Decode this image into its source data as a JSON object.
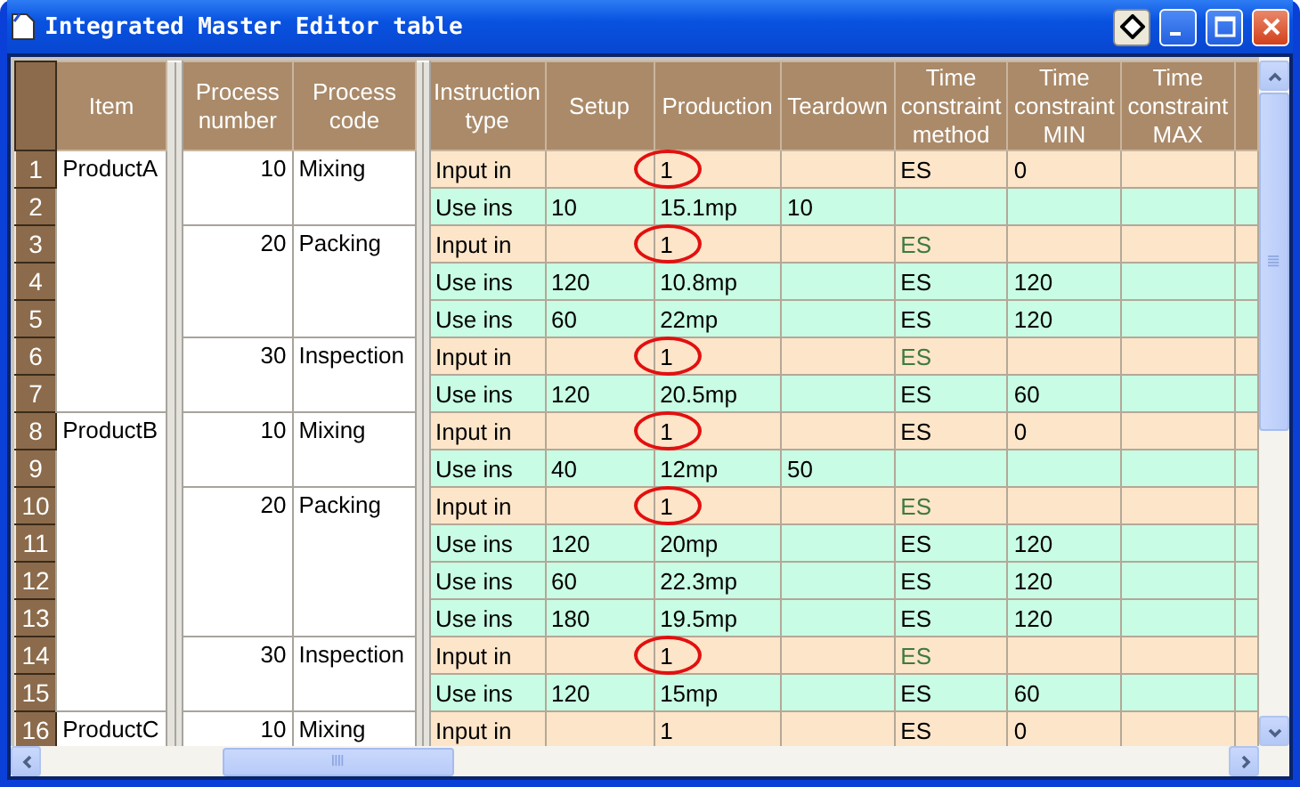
{
  "window": {
    "title": "Integrated Master Editor table"
  },
  "columns": {
    "item": "Item",
    "process_number": "Process number",
    "process_code": "Process code",
    "instruction_type": "Instruction type",
    "setup": "Setup",
    "production": "Production",
    "teardown": "Teardown",
    "method": "Time constraint method",
    "min": "Time constraint MIN",
    "max": "Time constraint MAX"
  },
  "products": [
    {
      "item": "ProductA",
      "processes": [
        {
          "number": "10",
          "code": "Mixing",
          "instructions": [
            {
              "row": "1",
              "kind": "input",
              "type": "Input in",
              "production": "1",
              "circled": true,
              "method": "ES",
              "method_dimmed": false,
              "min": "0"
            },
            {
              "row": "2",
              "kind": "use",
              "type": "Use ins",
              "setup": "10",
              "production": "15.1mp",
              "circled": false,
              "teardown": "10"
            }
          ]
        },
        {
          "number": "20",
          "code": "Packing",
          "instructions": [
            {
              "row": "3",
              "kind": "input",
              "type": "Input in",
              "production": "1",
              "circled": true,
              "method": "ES",
              "method_dimmed": true
            },
            {
              "row": "4",
              "kind": "use",
              "type": "Use ins",
              "setup": "120",
              "production": "10.8mp",
              "circled": false,
              "method": "ES",
              "method_dimmed": false,
              "min": "120"
            },
            {
              "row": "5",
              "kind": "use",
              "type": "Use ins",
              "setup": "60",
              "production": "22mp",
              "circled": false,
              "method": "ES",
              "method_dimmed": false,
              "min": "120"
            }
          ]
        },
        {
          "number": "30",
          "code": "Inspection",
          "instructions": [
            {
              "row": "6",
              "kind": "input",
              "type": "Input in",
              "production": "1",
              "circled": true,
              "method": "ES",
              "method_dimmed": true
            },
            {
              "row": "7",
              "kind": "use",
              "type": "Use ins",
              "setup": "120",
              "production": "20.5mp",
              "circled": false,
              "method": "ES",
              "method_dimmed": false,
              "min": "60"
            }
          ]
        }
      ]
    },
    {
      "item": "ProductB",
      "processes": [
        {
          "number": "10",
          "code": "Mixing",
          "instructions": [
            {
              "row": "8",
              "kind": "input",
              "type": "Input in",
              "production": "1",
              "circled": true,
              "method": "ES",
              "method_dimmed": false,
              "min": "0"
            },
            {
              "row": "9",
              "kind": "use",
              "type": "Use ins",
              "setup": "40",
              "production": "12mp",
              "circled": false,
              "teardown": "50"
            }
          ]
        },
        {
          "number": "20",
          "code": "Packing",
          "instructions": [
            {
              "row": "10",
              "kind": "input",
              "type": "Input in",
              "production": "1",
              "circled": true,
              "method": "ES",
              "method_dimmed": true
            },
            {
              "row": "11",
              "kind": "use",
              "type": "Use ins",
              "setup": "120",
              "production": "20mp",
              "circled": false,
              "method": "ES",
              "method_dimmed": false,
              "min": "120"
            },
            {
              "row": "12",
              "kind": "use",
              "type": "Use ins",
              "setup": "60",
              "production": "22.3mp",
              "circled": false,
              "method": "ES",
              "method_dimmed": false,
              "min": "120"
            },
            {
              "row": "13",
              "kind": "use",
              "type": "Use ins",
              "setup": "180",
              "production": "19.5mp",
              "circled": false,
              "method": "ES",
              "method_dimmed": false,
              "min": "120"
            }
          ]
        },
        {
          "number": "30",
          "code": "Inspection",
          "instructions": [
            {
              "row": "14",
              "kind": "input",
              "type": "Input in",
              "production": "1",
              "circled": true,
              "method": "ES",
              "method_dimmed": true
            },
            {
              "row": "15",
              "kind": "use",
              "type": "Use ins",
              "setup": "120",
              "production": "15mp",
              "circled": false,
              "method": "ES",
              "method_dimmed": false,
              "min": "60"
            }
          ]
        }
      ]
    },
    {
      "item": "ProductC",
      "processes": [
        {
          "number": "10",
          "code": "Mixing",
          "instructions": [
            {
              "row": "16",
              "kind": "input",
              "type": "Input in",
              "production": "1",
              "circled": false,
              "method": "ES",
              "method_dimmed": false,
              "min": "0"
            }
          ]
        }
      ]
    }
  ]
}
